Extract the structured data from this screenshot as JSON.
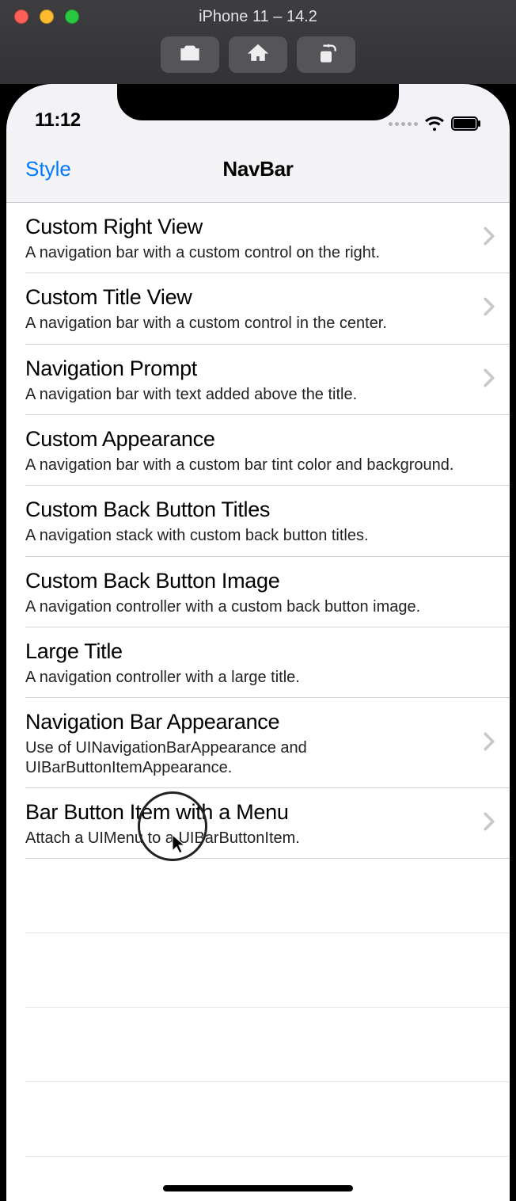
{
  "simulator": {
    "title": "iPhone 11 – 14.2",
    "tools": {
      "screenshot": "camera-icon",
      "home": "home-icon",
      "share": "share-icon"
    }
  },
  "status": {
    "time": "11:12"
  },
  "nav": {
    "back_label": "Style",
    "title": "NavBar"
  },
  "rows": [
    {
      "title": "Custom Right View",
      "subtitle": "A navigation bar with a custom control on the right.",
      "chevron": true
    },
    {
      "title": "Custom Title View",
      "subtitle": "A navigation bar with a custom control in the center.",
      "chevron": true
    },
    {
      "title": "Navigation Prompt",
      "subtitle": "A navigation bar with text added above the title.",
      "chevron": true
    },
    {
      "title": "Custom Appearance",
      "subtitle": "A navigation bar with a custom bar tint color and background.",
      "chevron": false
    },
    {
      "title": "Custom Back Button Titles",
      "subtitle": "A navigation stack with custom back button titles.",
      "chevron": false
    },
    {
      "title": "Custom Back Button Image",
      "subtitle": "A navigation controller with a custom back button image.",
      "chevron": false
    },
    {
      "title": "Large Title",
      "subtitle": "A navigation controller with a large title.",
      "chevron": false
    },
    {
      "title": "Navigation Bar Appearance",
      "subtitle": "Use of UINavigationBarAppearance and UIBarButtonItemAppearance.",
      "chevron": true
    },
    {
      "title": "Bar Button Item with a Menu",
      "subtitle": "Attach a UIMenu to a UIBarButtonItem.",
      "chevron": true
    }
  ]
}
